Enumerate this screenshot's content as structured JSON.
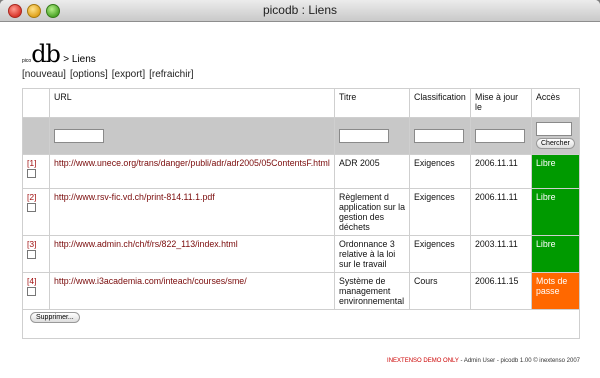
{
  "window": {
    "title": "picodb : Liens"
  },
  "header": {
    "logo_small": "pico",
    "logo_big": "db",
    "breadcrumb": "> Liens"
  },
  "menu": [
    "[nouveau]",
    "[options]",
    "[export]",
    "[refraichir]"
  ],
  "table": {
    "columns": [
      "URL",
      "Titre",
      "Classification",
      "Mise à jour le",
      "Accès"
    ],
    "search_button": "Chercher",
    "rows": [
      {
        "num": "[1]",
        "url": "http://www.unece.org/trans/danger/publi/adr/adr2005/05ContentsF.html",
        "titre": "ADR 2005",
        "classification": "Exigences",
        "date": "2006.11.11",
        "acces": "Libre",
        "acces_color": "#009a00"
      },
      {
        "num": "[2]",
        "url": "http://www.rsv-fic.vd.ch/print-814.11.1.pdf",
        "titre": "Règlement d application sur la gestion des déchets",
        "classification": "Exigences",
        "date": "2006.11.11",
        "acces": "Libre",
        "acces_color": "#009a00"
      },
      {
        "num": "[3]",
        "url": "http://www.admin.ch/ch/f/rs/822_113/index.html",
        "titre": "Ordonnance 3 relative à la loi sur le travail",
        "classification": "Exigences",
        "date": "2003.11.11",
        "acces": "Libre",
        "acces_color": "#009a00"
      },
      {
        "num": "[4]",
        "url": "http://www.i3academia.com/inteach/courses/sme/",
        "titre": "Système de management environnemental",
        "classification": "Cours",
        "date": "2006.11.15",
        "acces": "Mots de passe",
        "acces_color": "#ff6800"
      }
    ]
  },
  "supprimer_button": "Supprimer...",
  "footer": {
    "demo": "INEXTENSO DEMO ONLY",
    "info": "- Admin User - picodb 1.00 © inextenso 2007"
  }
}
